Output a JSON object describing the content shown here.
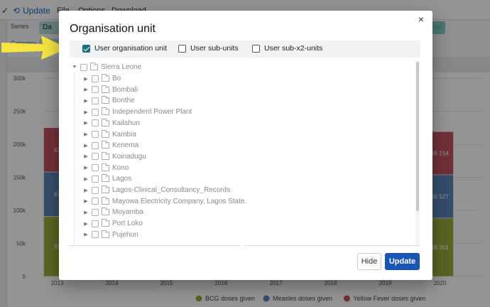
{
  "menubar": {
    "update_label": "Update",
    "items": [
      "File",
      "Options",
      "Download"
    ]
  },
  "layout": {
    "series_label": "Series",
    "category_label": "Category",
    "series_chip": "Da",
    "category_chip": "Pe"
  },
  "colors": {
    "bcg": "#9aad3d",
    "measles": "#5c86b8",
    "yellow_fever": "#c3545f",
    "accent": "#1a56b8"
  },
  "chart_data": {
    "type": "bar",
    "stacked": true,
    "categories": [
      "2013",
      "2014",
      "2015",
      "2016",
      "2017",
      "2018",
      "2019",
      "2020"
    ],
    "yticks": [
      "0",
      "50k",
      "100k",
      "150k",
      "200k",
      "250k",
      "300k"
    ],
    "ylim": [
      0,
      300000
    ],
    "visible_categories": [
      "2013",
      "2020"
    ],
    "series": [
      {
        "name": "BCG doses given",
        "values": [
          91000,
          null,
          null,
          null,
          null,
          null,
          null,
          88301
        ],
        "labels": [
          "91",
          "",
          "",
          "",
          "",
          "",
          "",
          "88 301"
        ]
      },
      {
        "name": "Measles doses given",
        "values": [
          67000,
          null,
          null,
          null,
          null,
          null,
          null,
          65527
        ],
        "labels": [
          "67",
          "",
          "",
          "",
          "",
          "",
          "",
          "65 527"
        ]
      },
      {
        "name": "Yellow Fever doses given",
        "values": [
          67000,
          null,
          null,
          null,
          null,
          null,
          null,
          65214
        ],
        "labels": [
          "67",
          "",
          "",
          "",
          "",
          "",
          "",
          "65 214"
        ]
      }
    ]
  },
  "dialog": {
    "title": "Organisation unit",
    "close_label": "×",
    "options": [
      {
        "label": "User organisation unit",
        "checked": true
      },
      {
        "label": "User sub-units",
        "checked": false
      },
      {
        "label": "User sub-x2-units",
        "checked": false
      }
    ],
    "tree_root": "Sierra Leone",
    "tree_items": [
      "Bo",
      "Bombali",
      "Bonthe",
      "Independent Power Plant",
      "Kailahun",
      "Kambia",
      "Kenema",
      "Koinadugu",
      "Kono",
      "Lagos",
      "Lagos-Clinical_Consultancy_Records",
      "Mayowa Electricity Company, Lagos State.",
      "Moyamba",
      "Port Loko",
      "Pujehun"
    ],
    "hide_label": "Hide",
    "update_label": "Update"
  }
}
